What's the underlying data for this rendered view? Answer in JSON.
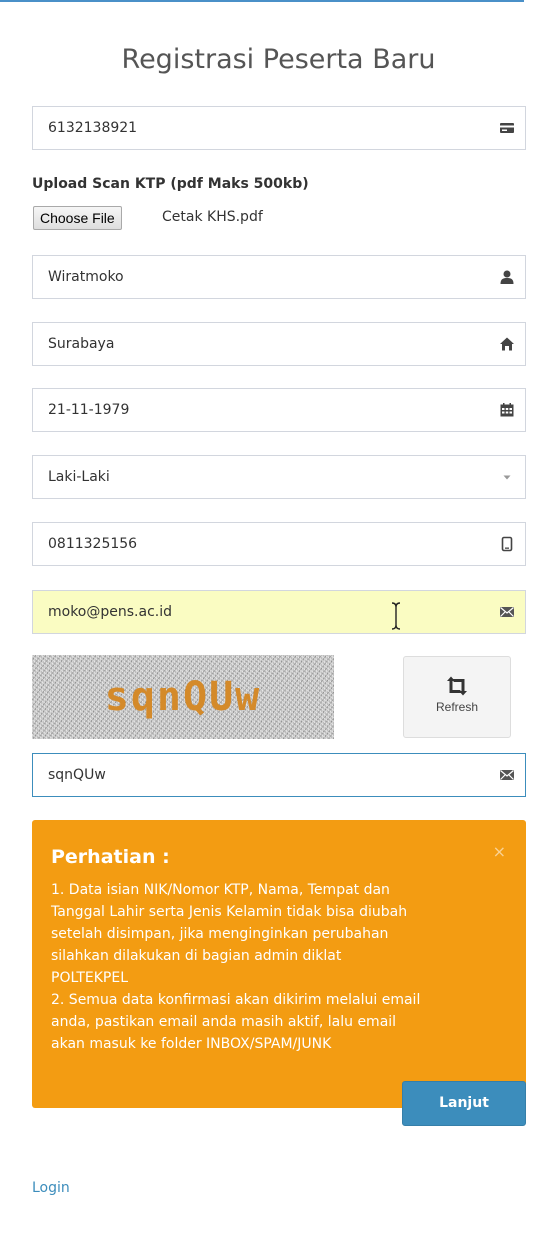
{
  "page": {
    "title": "Registrasi Peserta Baru"
  },
  "form": {
    "nik": {
      "value": "6132138921",
      "icon": "id-card-icon"
    },
    "upload": {
      "label": "Upload Scan KTP (pdf Maks 500kb)",
      "button_label": "Choose File",
      "file_name": "Cetak KHS.pdf"
    },
    "nama": {
      "value": "Wiratmoko",
      "icon": "user-icon"
    },
    "tempat_lahir": {
      "value": "Surabaya",
      "icon": "home-icon"
    },
    "tanggal_lahir": {
      "value": "21-11-1979",
      "icon": "calendar-icon"
    },
    "jenis_kelamin": {
      "value": "Laki-Laki",
      "icon": "caret-down-icon"
    },
    "telepon": {
      "value": "0811325156",
      "icon": "mobile-phone-icon"
    },
    "email": {
      "value": "moko@pens.ac.id",
      "icon": "envelope-icon"
    },
    "captcha": {
      "image_text": "sqnQUw",
      "refresh_label": "Refresh",
      "input_value": "sqnQUw",
      "input_icon": "envelope-icon"
    }
  },
  "alert": {
    "title": "Perhatian :",
    "close": "×",
    "lines": [
      "1. Data isian NIK/Nomor KTP, Nama, Tempat dan",
      "Tanggal Lahir serta Jenis Kelamin tidak bisa diubah",
      "setelah disimpan, jika menginginkan perubahan",
      "silahkan dilakukan di bagian admin diklat",
      "POLTEKPEL",
      "2. Semua data konfirmasi akan dikirim melalui email",
      "anda, pastikan email anda masih aktif, lalu email",
      "akan masuk ke folder INBOX/SPAM/JUNK"
    ]
  },
  "actions": {
    "submit_label": "Lanjut",
    "login_link": "Login"
  },
  "colors": {
    "primary": "#3c8dbc",
    "warning": "#f39c12",
    "autofill_bg": "#fafcc2",
    "captcha_text": "#d48a2a"
  }
}
